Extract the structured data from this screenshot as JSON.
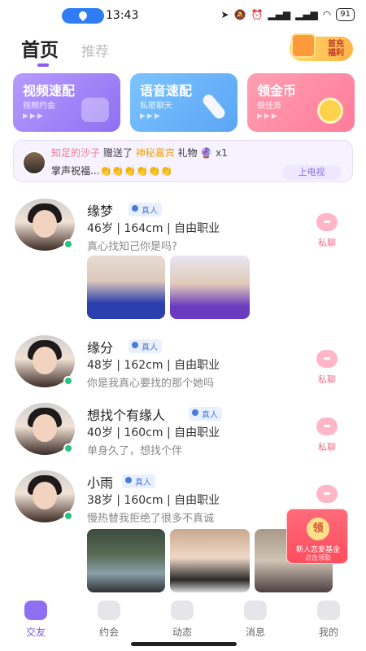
{
  "status_bar": {
    "time": "13:43",
    "battery": "91"
  },
  "header": {
    "tabs": [
      {
        "label": "首页"
      },
      {
        "label": "推荐"
      }
    ],
    "first_charge": "首充福利"
  },
  "feature_cards": [
    {
      "title": "视频速配",
      "subtitle": "视频约会"
    },
    {
      "title": "语音速配",
      "subtitle": "私密聊天"
    },
    {
      "title": "领金币",
      "subtitle": "做任务"
    }
  ],
  "gift_banner": {
    "sender": "知足的沙子",
    "action": "赠送了",
    "receiver": "神秘嘉宾",
    "gift_word": "礼物",
    "count": "x1",
    "message": "掌声祝福...👏👏👏👏👏👏",
    "tv_button": "上电视"
  },
  "badge_label": "真人",
  "chat_label": "私聊",
  "users": [
    {
      "name": "缘梦",
      "meta": "46岁 | 164cm | 自由职业",
      "bio": "真心找知己你是吗?"
    },
    {
      "name": "缘分",
      "meta": "48岁 | 162cm | 自由职业",
      "bio": "你是我真心要找的那个她吗"
    },
    {
      "name": "想找个有缘人",
      "meta": "40岁 | 160cm | 自由职业",
      "bio": "单身久了，想找个伴"
    },
    {
      "name": "小雨",
      "meta": "38岁 | 160cm | 自由职业",
      "bio": "慢热替我拒绝了很多不真诚"
    }
  ],
  "envelope": {
    "seal": "领",
    "line1": "新人恋爱基金",
    "line2": "点击领取"
  },
  "bottom_nav": [
    {
      "label": "交友"
    },
    {
      "label": "约会"
    },
    {
      "label": "动态"
    },
    {
      "label": "消息"
    },
    {
      "label": "我的"
    }
  ],
  "colors": {
    "accent": "#8f6ff2",
    "pink": "#f26d8c",
    "online": "#26c281"
  }
}
